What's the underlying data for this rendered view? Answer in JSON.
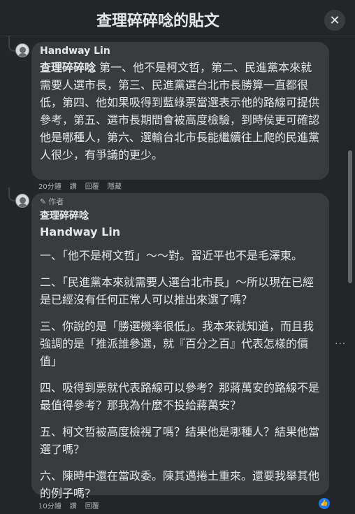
{
  "header": {
    "title": "查理碎碎唸的貼文",
    "close_symbol": "✕"
  },
  "comments": [
    {
      "author": "Handway Lin",
      "mention": "查理碎碎唸",
      "text": " 第一、他不是柯文哲，第二、民進黨本來就需要人選市長，第三、民進黨選台北市長勝算一直都很低，第四、他如果吸得到藍綠票當選表示他的路線可提供參考，第五、選市長期間會被高度檢驗，到時侯更可確認他是哪種人，第六、選輸台北市長能繼續往上爬的民進黨人很少，有爭議的更少。",
      "time": "20分鐘",
      "like": "讚",
      "reply": "回覆",
      "hide": "隱藏"
    },
    {
      "badge": "作者",
      "author": "查理碎碎唸",
      "reply_to": "Handway Lin",
      "paragraphs": [
        "一、「他不是柯文哲」～～對。習近平也不是毛澤東。",
        "二、「民進黨本來就需要人選台北市長」～所以現在已經是已經沒有任何正常人可以推出來選了嗎？",
        "三、你說的是「勝選機率很低」。我本來就知道，而且我強調的是「推派誰參選，就『百分之百』代表怎樣的價值」",
        "四、吸得到票就代表路線可以參考？那蔣萬安的路線不是最值得參考？那我為什麼不投給蔣萬安？",
        "五、柯文哲被高度檢視了嗎？結果他是哪種人？結果他當選了嗎？",
        "六、陳時中還在當政委。陳其邁捲土重來。還要我舉其他的例子嗎？"
      ],
      "time": "10分鐘",
      "like": "讚",
      "reply": "回覆",
      "more_symbol": "···",
      "like_icon_symbol": "👍"
    }
  ]
}
